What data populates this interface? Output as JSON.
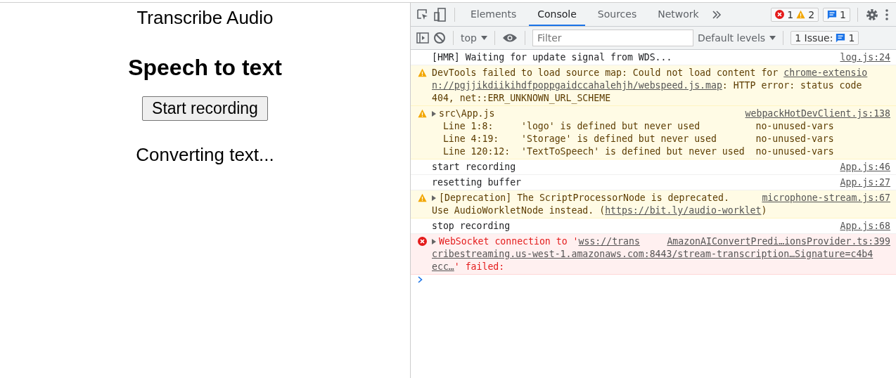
{
  "page": {
    "title": "Transcribe Audio",
    "heading": "Speech to text",
    "button": "Start recording",
    "status": "Converting text..."
  },
  "devtools": {
    "tabs": [
      {
        "label": "Elements",
        "selected": false
      },
      {
        "label": "Console",
        "selected": true
      },
      {
        "label": "Sources",
        "selected": false
      },
      {
        "label": "Network",
        "selected": false
      }
    ],
    "counters": {
      "errors": "1",
      "warnings": "2",
      "info": "1"
    },
    "toolbar": {
      "context": "top",
      "filter_placeholder": "Filter",
      "levels": "Default levels",
      "issues_label": "1 Issue:",
      "issues_count": "1"
    },
    "messages": [
      {
        "kind": "info",
        "expandable": false,
        "source": "log.js:24",
        "lines": [
          [
            {
              "text": "[HMR] Waiting for update signal from WDS...",
              "link": false
            }
          ]
        ]
      },
      {
        "kind": "warning",
        "expandable": false,
        "lines": [
          [
            {
              "text": "DevTools failed to load source map: Could not load content for ",
              "link": false
            },
            {
              "text": "chrome-extensio",
              "link": true
            }
          ],
          [
            {
              "text": "n://pgjjikdiikihdfpoppgaidccahalehjh/webspeed.js.map",
              "link": true
            },
            {
              "text": ": HTTP error: status code",
              "link": false
            }
          ],
          [
            {
              "text": "404, net::ERR_UNKNOWN_URL_SCHEME",
              "link": false
            }
          ]
        ]
      },
      {
        "kind": "warning",
        "expandable": true,
        "source": "webpackHotDevClient.js:138",
        "lines": [
          [
            {
              "text": "src\\App.js",
              "link": false
            }
          ],
          [
            {
              "text": "  Line 1:8:     'logo' is defined but never used          no-unused-vars",
              "link": false
            }
          ],
          [
            {
              "text": "  Line 4:19:    'Storage' is defined but never used       no-unused-vars",
              "link": false
            }
          ],
          [
            {
              "text": "  Line 120:12:  'TextToSpeech' is defined but never used  no-unused-vars",
              "link": false
            }
          ]
        ]
      },
      {
        "kind": "info",
        "expandable": false,
        "source": "App.js:46",
        "lines": [
          [
            {
              "text": "start recording",
              "link": false
            }
          ]
        ]
      },
      {
        "kind": "info",
        "expandable": false,
        "source": "App.js:27",
        "lines": [
          [
            {
              "text": "resetting buffer",
              "link": false
            }
          ]
        ]
      },
      {
        "kind": "warning",
        "expandable": true,
        "source": "microphone-stream.js:67",
        "lines": [
          [
            {
              "text": "[Deprecation] The ScriptProcessorNode is deprecated.",
              "link": false
            }
          ],
          [
            {
              "text": "Use AudioWorkletNode instead. (",
              "link": false
            },
            {
              "text": "https://bit.ly/audio-worklet",
              "link": true
            },
            {
              "text": ")",
              "link": false
            }
          ]
        ]
      },
      {
        "kind": "info",
        "expandable": false,
        "source": "App.js:68",
        "lines": [
          [
            {
              "text": "stop recording",
              "link": false
            }
          ]
        ]
      },
      {
        "kind": "error",
        "expandable": true,
        "source": "AmazonAIConvertPredi…ionsProvider.ts:399",
        "lines": [
          [
            {
              "text": "WebSocket connection to '",
              "link": false
            },
            {
              "text": "wss://trans",
              "link": true
            }
          ],
          [
            {
              "text": "cribestreaming.us-west-1.amazonaws.com:8443/stream-transcription…Signature=c4b4",
              "link": true
            }
          ],
          [
            {
              "text": "ecc…",
              "link": true
            },
            {
              "text": "' failed:",
              "link": false
            }
          ]
        ]
      }
    ]
  }
}
